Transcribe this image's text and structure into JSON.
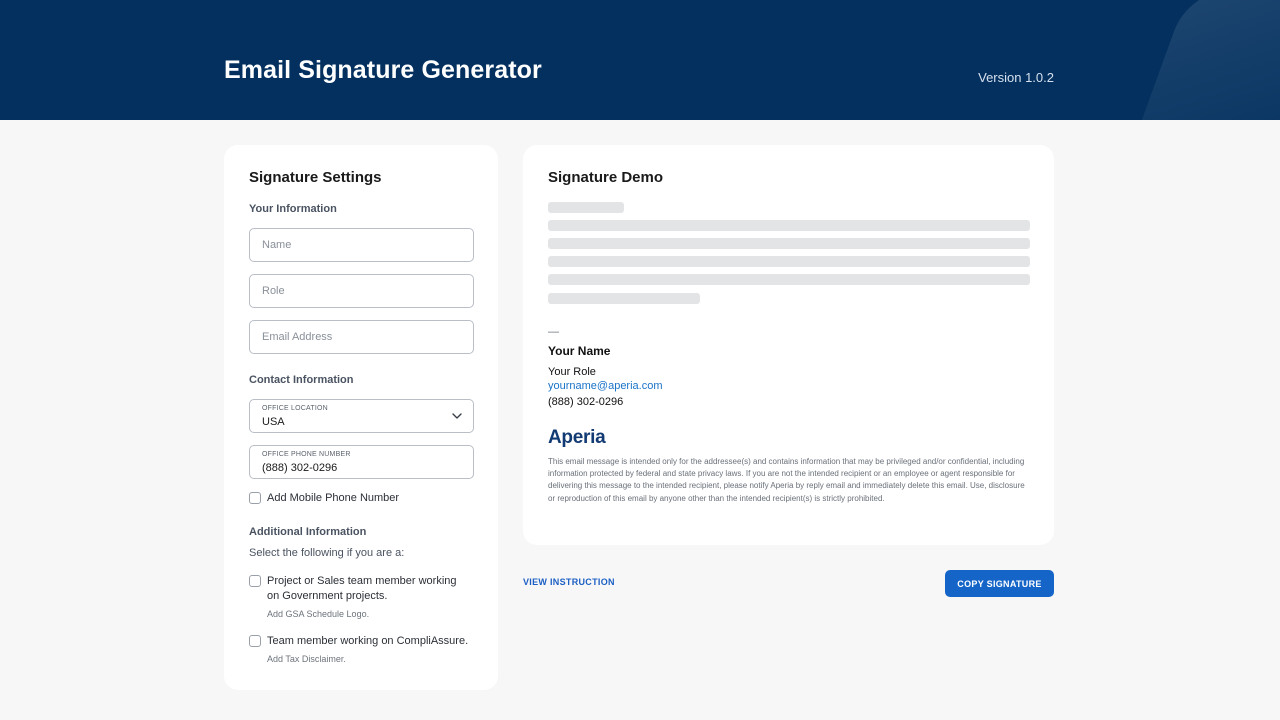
{
  "header": {
    "title": "Email Signature Generator",
    "version": "Version 1.0.2",
    "background_color": "#03305f"
  },
  "settings": {
    "title": "Signature Settings",
    "your_information": {
      "label": "Your Information",
      "name_placeholder": "Name",
      "role_placeholder": "Role",
      "email_placeholder": "Email Address"
    },
    "contact_information": {
      "label": "Contact Information",
      "office_location_label": "OFFICE LOCATION",
      "office_location_value": "USA",
      "office_phone_label": "OFFICE PHONE NUMBER",
      "office_phone_value": "(888) 302-0296",
      "mobile_checkbox_label": "Add Mobile Phone Number",
      "mobile_checked": false
    },
    "additional_information": {
      "label": "Additional Information",
      "instruction": "Select the following if you are a:",
      "options": [
        {
          "label_line1": "Project or Sales team member working",
          "label_line2": "on Government projects.",
          "hint": "Add GSA Schedule Logo.",
          "checked": false
        },
        {
          "label_line1": "Team member working on CompliAssure.",
          "hint": "Add Tax Disclaimer.",
          "checked": false
        }
      ]
    }
  },
  "demo": {
    "title": "Signature Demo",
    "separator": "—",
    "name": "Your Name",
    "role": "Your Role",
    "email": "yourname@aperia.com",
    "phone": "(888) 302-0296",
    "logo_text": "Aperia",
    "disclaimer": "This email message is intended only for the addressee(s) and contains information that may be privileged and/or confidential, including information protected by federal and state privacy laws. If you are not the intended recipient or an employee or agent responsible for delivering this message to the intended recipient, please notify Aperia by reply email and immediately delete this email. Use, disclosure or reproduction of this email by anyone other than the intended recipient(s) is strictly prohibited."
  },
  "actions": {
    "view_instruction": "VIEW INSTRUCTION",
    "copy_signature": "COPY SIGNATURE",
    "primary_color": "#1565c8"
  }
}
